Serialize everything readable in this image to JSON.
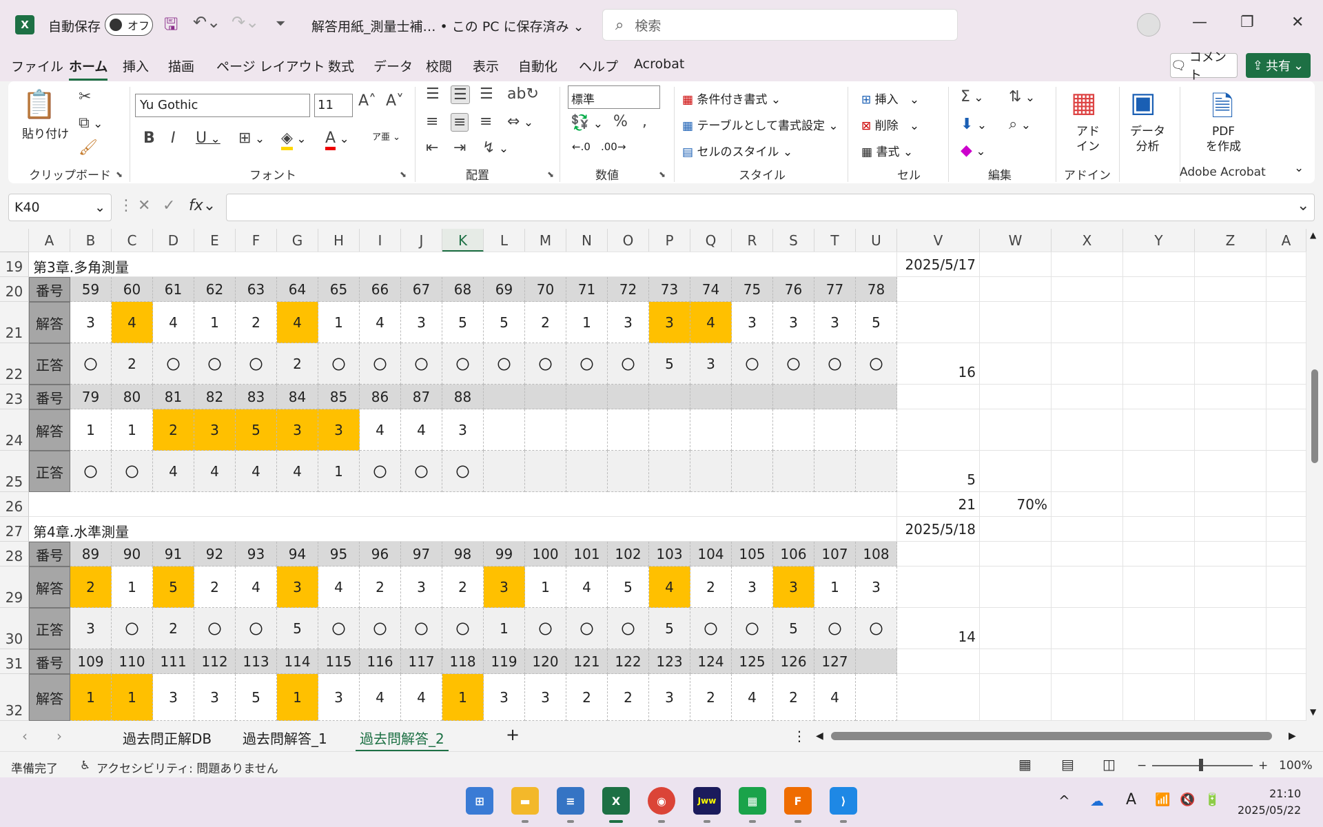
{
  "titlebar": {
    "autosave_label": "自動保存",
    "autosave_state": "オフ",
    "document_title": "解答用紙_測量士補… • この PC に保存済み ⌄",
    "search_placeholder": "検索"
  },
  "ribbon_tabs": [
    "ファイル",
    "ホーム",
    "挿入",
    "描画",
    "ページ レイアウト",
    "数式",
    "データ",
    "校閲",
    "表示",
    "自動化",
    "ヘルプ",
    "Acrobat"
  ],
  "active_tab": "ホーム",
  "comment_label": "コメント",
  "share_label": "共有",
  "ribbon": {
    "clipboard": {
      "paste": "貼り付け",
      "label": "クリップボード"
    },
    "font": {
      "name": "Yu Gothic",
      "size": "11",
      "label": "フォント"
    },
    "alignment": {
      "label": "配置"
    },
    "number": {
      "format": "標準",
      "label": "数値"
    },
    "styles": {
      "conditional": "条件付き書式",
      "table": "テーブルとして書式設定",
      "cell_style": "セルのスタイル",
      "label": "スタイル"
    },
    "cells": {
      "insert": "挿入",
      "delete": "削除",
      "format": "書式",
      "label": "セル"
    },
    "editing": {
      "label": "編集"
    },
    "addin": {
      "button_line1": "アド",
      "button_line2": "イン",
      "label": "アドイン"
    },
    "analysis": {
      "button_line1": "データ",
      "button_line2": "分析"
    },
    "acrobat": {
      "button_line1": "PDF",
      "button_line2": "を作成",
      "label": "Adobe Acrobat"
    }
  },
  "formula_bar": {
    "name_box": "K40",
    "formula": ""
  },
  "columns": [
    "A",
    "B",
    "C",
    "D",
    "E",
    "F",
    "G",
    "H",
    "I",
    "J",
    "K",
    "L",
    "M",
    "N",
    "O",
    "P",
    "Q",
    "R",
    "S",
    "T",
    "U",
    "V",
    "W",
    "X",
    "Y",
    "Z",
    "A"
  ],
  "selected_column": "K",
  "rows": [
    "19",
    "20",
    "21",
    "22",
    "23",
    "24",
    "25",
    "26",
    "27",
    "28",
    "29",
    "30",
    "31",
    "32"
  ],
  "sections": [
    {
      "title": "第3章.多角測量",
      "date": "2025/5/17",
      "blocks": [
        {
          "numbers": [
            "59",
            "60",
            "61",
            "62",
            "63",
            "64",
            "65",
            "66",
            "67",
            "68",
            "69",
            "70",
            "71",
            "72",
            "73",
            "74",
            "75",
            "76",
            "77",
            "78"
          ],
          "answers": [
            "3",
            "4",
            "4",
            "1",
            "2",
            "4",
            "1",
            "4",
            "3",
            "5",
            "5",
            "2",
            "1",
            "3",
            "3",
            "4",
            "3",
            "3",
            "3",
            "5"
          ],
          "corrects": [
            "〇",
            "2",
            "〇",
            "〇",
            "〇",
            "2",
            "〇",
            "〇",
            "〇",
            "〇",
            "〇",
            "〇",
            "〇",
            "〇",
            "5",
            "3",
            "〇",
            "〇",
            "〇",
            "〇"
          ],
          "score": "16"
        },
        {
          "numbers": [
            "79",
            "80",
            "81",
            "82",
            "83",
            "84",
            "85",
            "86",
            "87",
            "88"
          ],
          "answers": [
            "1",
            "1",
            "2",
            "3",
            "5",
            "3",
            "3",
            "4",
            "4",
            "3"
          ],
          "corrects": [
            "〇",
            "〇",
            "4",
            "4",
            "4",
            "4",
            "1",
            "〇",
            "〇",
            "〇"
          ],
          "score": "5"
        }
      ],
      "total": "21",
      "rate": "70%"
    },
    {
      "title": "第4章.水準測量",
      "date": "2025/5/18",
      "blocks": [
        {
          "numbers": [
            "89",
            "90",
            "91",
            "92",
            "93",
            "94",
            "95",
            "96",
            "97",
            "98",
            "99",
            "100",
            "101",
            "102",
            "103",
            "104",
            "105",
            "106",
            "107",
            "108"
          ],
          "answers": [
            "2",
            "1",
            "5",
            "2",
            "4",
            "3",
            "4",
            "2",
            "3",
            "2",
            "3",
            "1",
            "4",
            "5",
            "4",
            "2",
            "3",
            "3",
            "1",
            "3"
          ],
          "corrects": [
            "3",
            "〇",
            "2",
            "〇",
            "〇",
            "5",
            "〇",
            "〇",
            "〇",
            "〇",
            "1",
            "〇",
            "〇",
            "〇",
            "5",
            "〇",
            "〇",
            "5",
            "〇",
            "〇"
          ],
          "score": "14"
        },
        {
          "numbers": [
            "109",
            "110",
            "111",
            "112",
            "113",
            "114",
            "115",
            "116",
            "117",
            "118",
            "119",
            "120",
            "121",
            "122",
            "123",
            "124",
            "125",
            "126",
            "127"
          ],
          "answers": [
            "1",
            "1",
            "3",
            "3",
            "5",
            "1",
            "3",
            "4",
            "4",
            "1",
            "3",
            "3",
            "2",
            "2",
            "3",
            "2",
            "4",
            "2",
            "4"
          ]
        }
      ]
    }
  ],
  "row_labels": {
    "number": "番号",
    "answer": "解答",
    "correct": "正答"
  },
  "sheet_tabs": [
    "過去問正解DB",
    "過去問解答_1",
    "過去問解答_2"
  ],
  "active_sheet": "過去問解答_2",
  "status": {
    "ready": "準備完了",
    "accessibility": "アクセシビリティ: 問題ありません",
    "zoom": "100%"
  },
  "clock": {
    "time": "21:10",
    "date": "2025/05/22"
  },
  "colors": {
    "excel_green": "#1d7044",
    "wrong_highlight": "#ffc000",
    "label_gray": "#a6a6a6"
  }
}
